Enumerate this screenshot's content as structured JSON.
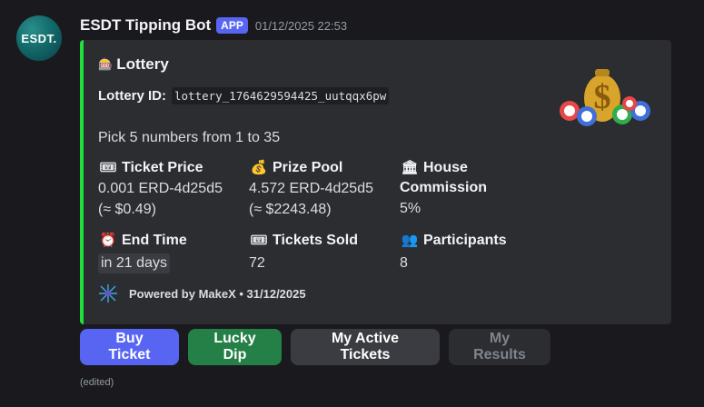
{
  "message": {
    "avatar_text": "ESDT.",
    "bot_name": "ESDT Tipping Bot",
    "badge": "APP",
    "timestamp": "01/12/2025 22:53",
    "edited": "(edited)"
  },
  "embed": {
    "accent_color": "#22e03c",
    "title": "Lottery",
    "title_icon": "slot-machine-icon",
    "lottery_id_label": "Lottery ID:",
    "lottery_id_value": "lottery_1764629594425_uutqqx6pw",
    "pick_text": "Pick 5 numbers from 1 to 35",
    "thumbnail_icon": "money-bag-lottery-balls-icon",
    "fields": [
      {
        "icon": "ticket-icon",
        "name": "Ticket Price",
        "value_line1": "0.001 ERD-4d25d5",
        "value_line2": "(≈ $0.49)"
      },
      {
        "icon": "money-bag-icon",
        "name": "Prize Pool",
        "value_line1": "4.572 ERD-4d25d5",
        "value_line2": "(≈ $2243.48)"
      },
      {
        "icon": "bank-icon",
        "name_line1": "House",
        "name_line2": "Commission",
        "value": "5%"
      },
      {
        "icon": "alarm-clock-icon",
        "name": "End Time",
        "value": "in 21 days"
      },
      {
        "icon": "ticket-icon",
        "name": "Tickets Sold",
        "value": "72"
      },
      {
        "icon": "participants-icon",
        "name": "Participants",
        "value": "8"
      }
    ],
    "footer": {
      "icon": "makex-logo-icon",
      "text": "Powered by MakeX • 31/12/2025"
    }
  },
  "buttons": {
    "buy_ticket": "Buy Ticket",
    "lucky_dip": "Lucky Dip",
    "my_active_tickets": "My Active Tickets",
    "my_results": "My Results"
  },
  "colors": {
    "primary": "#5865f2",
    "success": "#248046",
    "secondary": "#3a3c42"
  }
}
